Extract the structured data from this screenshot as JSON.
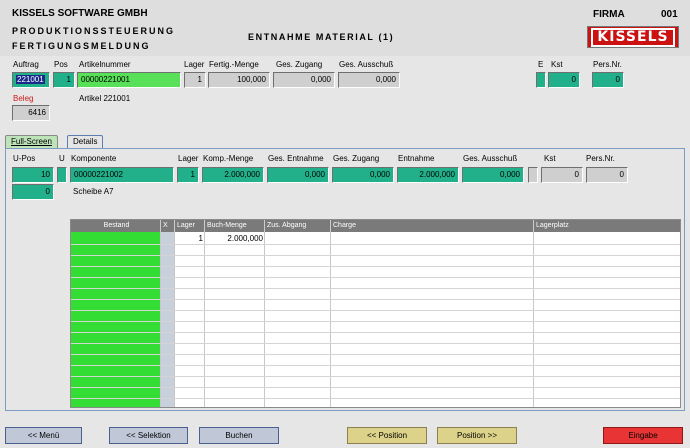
{
  "header": {
    "company": "KISSELS SOFTWARE GMBH",
    "line1": "PRODUKTIONSSTEUERUNG",
    "line2": "FERTIGUNGSMELDUNG",
    "screen_title": "ENTNAHME MATERIAL (1)",
    "firma_label": "FIRMA",
    "firma_value": "001",
    "logo_text": "KISSELS"
  },
  "order": {
    "auftrag_label": "Auftrag",
    "auftrag_value": "221001",
    "pos_label": "Pos",
    "pos_value": "1",
    "artikelnummer_label": "Artikelnummer",
    "artikelnummer_value": "00000221001",
    "lager_label": "Lager",
    "lager_value": "1",
    "fertig_menge_label": "Fertig.-Menge",
    "fertig_menge_value": "100,000",
    "ges_zugang_label": "Ges. Zugang",
    "ges_zugang_value": "0,000",
    "ges_ausschuss_label": "Ges. Ausschuß",
    "ges_ausschuss_value": "0,000",
    "e_label": "E",
    "e_value": "",
    "kst_label": "Kst",
    "kst_value": "0",
    "persnr_label": "Pers.Nr.",
    "persnr_value": "0",
    "beleg_label": "Beleg",
    "beleg_value": "6416",
    "artikel_text": "Artikel 221001"
  },
  "tabs": {
    "full": "Full-Screen",
    "details": "Details"
  },
  "component": {
    "upos_label": "U-Pos",
    "upos_value": "10",
    "upos_sub": "0",
    "u_label": "U",
    "u_value": "",
    "komponente_label": "Komponente",
    "komponente_value": "00000221002",
    "lager_label": "Lager",
    "lager_value": "1",
    "komp_menge_label": "Komp.-Menge",
    "komp_menge_value": "2.000,000",
    "ges_entnahme_label": "Ges. Entnahme",
    "ges_entnahme_value": "0,000",
    "ges_zugang_label": "Ges. Zugang",
    "ges_zugang_value": "0,000",
    "entnahme_label": "Entnahme",
    "entnahme_value": "2.000,000",
    "ges_ausschuss_label": "Ges. Ausschuß",
    "ges_ausschuss_value": "0,000",
    "kst_label": "Kst",
    "kst_value": "0",
    "persnr_label": "Pers.Nr.",
    "persnr_value": "0",
    "description": "Scheibe A7"
  },
  "grid": {
    "columns": [
      "Bestand",
      "X",
      "Lager",
      "Buch-Menge",
      "Zus. Abgang",
      "Charge",
      "Lagerplatz"
    ],
    "rows": [
      {
        "lager": "1",
        "buch_menge": "2.000,000"
      }
    ]
  },
  "buttons": {
    "menu": "<<  Menü",
    "selektion": "<<  Selektion",
    "buchen": "Buchen",
    "position_prev": "<< Position",
    "position_next": "Position >>",
    "eingabe": "Eingabe"
  }
}
